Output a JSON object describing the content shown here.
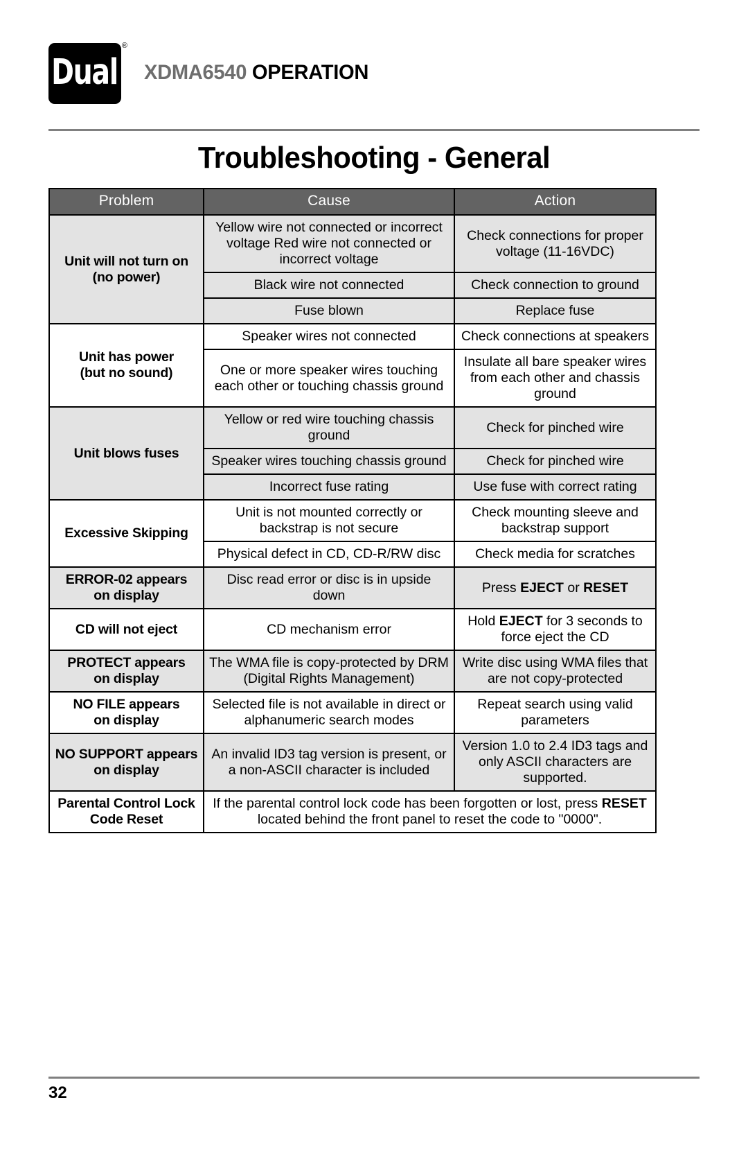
{
  "header": {
    "logo_text": "Dual",
    "logo_registered": "®",
    "model": "XDMA6540",
    "section": "OPERATION"
  },
  "page_title": "Troubleshooting - General",
  "table": {
    "columns": [
      "Problem",
      "Cause",
      "Action"
    ],
    "rows": [
      {
        "problem": "Unit will not turn on\n(no power)",
        "problem_line1": "Unit will not turn on",
        "problem_line2": "(no power)",
        "shaded": true,
        "entries": [
          {
            "cause": "Yellow wire not connected or incorrect voltage Red wire not connected or incorrect voltage",
            "action": "Check connections for proper voltage (11-16VDC)"
          },
          {
            "cause": "Black wire not connected",
            "action": "Check connection to ground"
          },
          {
            "cause": "Fuse blown",
            "action": "Replace fuse"
          }
        ]
      },
      {
        "problem_line1": "Unit has power",
        "problem_line2": "(but no sound)",
        "shaded": false,
        "entries": [
          {
            "cause": "Speaker wires not connected",
            "action": "Check connections at speakers"
          },
          {
            "cause": "One or more speaker wires touching each other or touching chassis ground",
            "action": "Insulate all bare speaker wires from each other and chassis ground"
          }
        ]
      },
      {
        "problem_line1": "Unit blows fuses",
        "problem_line2": "",
        "shaded": true,
        "entries": [
          {
            "cause": "Yellow or red wire touching chassis ground",
            "action": "Check for pinched wire"
          },
          {
            "cause": "Speaker wires touching chassis ground",
            "action": "Check for pinched wire"
          },
          {
            "cause": "Incorrect fuse rating",
            "action": "Use fuse with correct rating"
          }
        ]
      },
      {
        "problem_line1": "Excessive Skipping",
        "problem_line2": "",
        "shaded": false,
        "entries": [
          {
            "cause": "Unit is not mounted correctly or backstrap is not secure",
            "action": "Check mounting sleeve and backstrap support"
          },
          {
            "cause": "Physical defect in CD, CD-R/RW disc",
            "action": "Check media for scratches"
          }
        ]
      },
      {
        "problem_line1": "ERROR-02 appears",
        "problem_line2": "on display",
        "shaded": true,
        "entries": [
          {
            "cause": "Disc read error or disc is in upside down",
            "action_prefix": "Press ",
            "action_bold1": "EJECT",
            "action_mid": " or ",
            "action_bold2": "RESET",
            "action_suffix": ""
          }
        ]
      },
      {
        "problem_line1": "CD will not eject",
        "problem_line2": "",
        "shaded": false,
        "entries": [
          {
            "cause": "CD mechanism error",
            "action_prefix": "Hold ",
            "action_bold1": "EJECT",
            "action_mid": " for 3 seconds to force eject the CD",
            "action_bold2": "",
            "action_suffix": ""
          }
        ]
      },
      {
        "problem_line1": "PROTECT appears",
        "problem_line2": "on display",
        "shaded": true,
        "entries": [
          {
            "cause": "The WMA file is copy-protected by DRM (Digital Rights Management)",
            "action": "Write disc using WMA files that are not copy-protected"
          }
        ]
      },
      {
        "problem_line1": "NO FILE appears",
        "problem_line2": "on display",
        "shaded": false,
        "entries": [
          {
            "cause": "Selected file is not available in direct or alphanumeric search modes",
            "action": "Repeat search using valid parameters"
          }
        ]
      },
      {
        "problem_line1": "NO SUPPORT appears",
        "problem_line2": "on display",
        "shaded": true,
        "entries": [
          {
            "cause": "An invalid ID3 tag version is present, or a non-ASCII character is included",
            "action": "Version 1.0 to 2.4 ID3 tags and only ASCII characters are supported."
          }
        ]
      },
      {
        "problem_line1": "Parental Control Lock",
        "problem_line2": "Code Reset",
        "shaded": false,
        "span_note_prefix": "If the parental control lock code has been forgotten or lost, press ",
        "span_note_bold": "RESET",
        "span_note_suffix": " located behind the front panel to reset the code to \"0000\"."
      }
    ]
  },
  "footer": {
    "page_number": "32"
  },
  "colors": {
    "header_gray": "#636363",
    "row_shade": "#e3e3e3",
    "rule": "#808080",
    "model_text": "#6e6e6e"
  }
}
